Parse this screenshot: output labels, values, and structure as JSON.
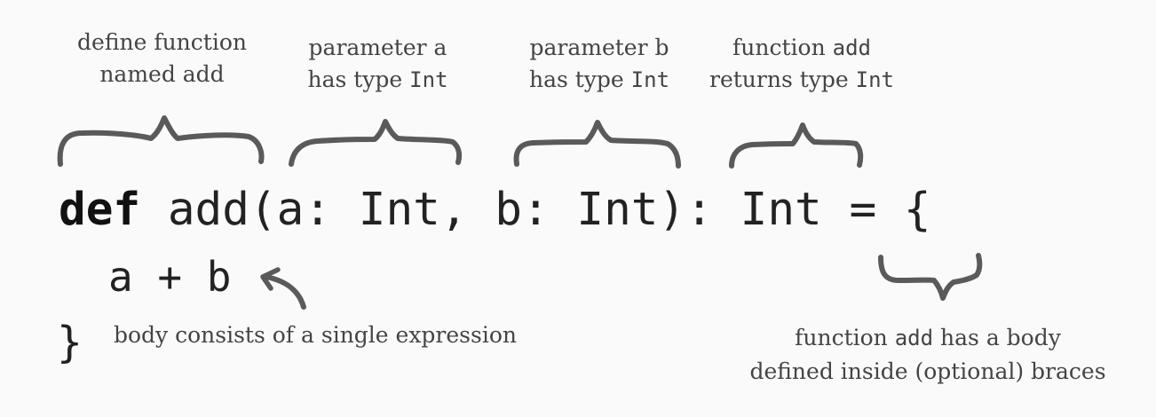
{
  "annotations": {
    "define": {
      "line1": "define function",
      "line2": "named add"
    },
    "param_a": {
      "line1": "parameter a",
      "line2_prefix": "has type ",
      "line2_type": "Int"
    },
    "param_b": {
      "line1": "parameter b",
      "line2_prefix": "has type ",
      "line2_type": "Int"
    },
    "returns": {
      "line1_prefix": "function ",
      "line1_name": "add",
      "line2_prefix": "returns type ",
      "line2_type": "Int"
    },
    "body_expr": {
      "text": "body consists of a single expression"
    },
    "body_braces": {
      "line1_prefix": "function ",
      "line1_name": "add",
      "line1_suffix": " has a body",
      "line2": "defined inside (optional) braces"
    }
  },
  "code": {
    "keyword": "def",
    "signature": " add(a: Int, b: Int): Int = {",
    "body": "a + b",
    "close": "}"
  },
  "colors": {
    "ink": "#5a5a5a",
    "text": "#444444",
    "code": "#222222",
    "background": "#fafafa"
  }
}
